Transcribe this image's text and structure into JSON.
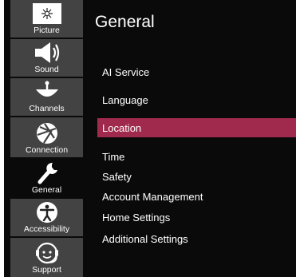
{
  "page": {
    "title": "General"
  },
  "sidebar": {
    "items": [
      {
        "label": "Picture",
        "icon": "picture-icon"
      },
      {
        "label": "Sound",
        "icon": "speaker-icon"
      },
      {
        "label": "Channels",
        "icon": "satellite-dish-icon"
      },
      {
        "label": "Connection",
        "icon": "globe-icon"
      },
      {
        "label": "General",
        "icon": "wrench-icon",
        "active": true
      },
      {
        "label": "Accessibility",
        "icon": "accessibility-icon"
      },
      {
        "label": "Support",
        "icon": "headset-icon"
      }
    ]
  },
  "menu": {
    "items": [
      {
        "label": "AI Service"
      },
      {
        "label": "Language"
      },
      {
        "label": "Location",
        "selected": true
      },
      {
        "label": "Time"
      },
      {
        "label": "Safety"
      },
      {
        "label": "Account Management"
      },
      {
        "label": "Home Settings"
      },
      {
        "label": "Additional Settings"
      }
    ]
  },
  "colors": {
    "background": "#0a0a0a",
    "sidebar_tile": "#434343",
    "selection": "#a02a4e",
    "text": "#ffffff"
  }
}
